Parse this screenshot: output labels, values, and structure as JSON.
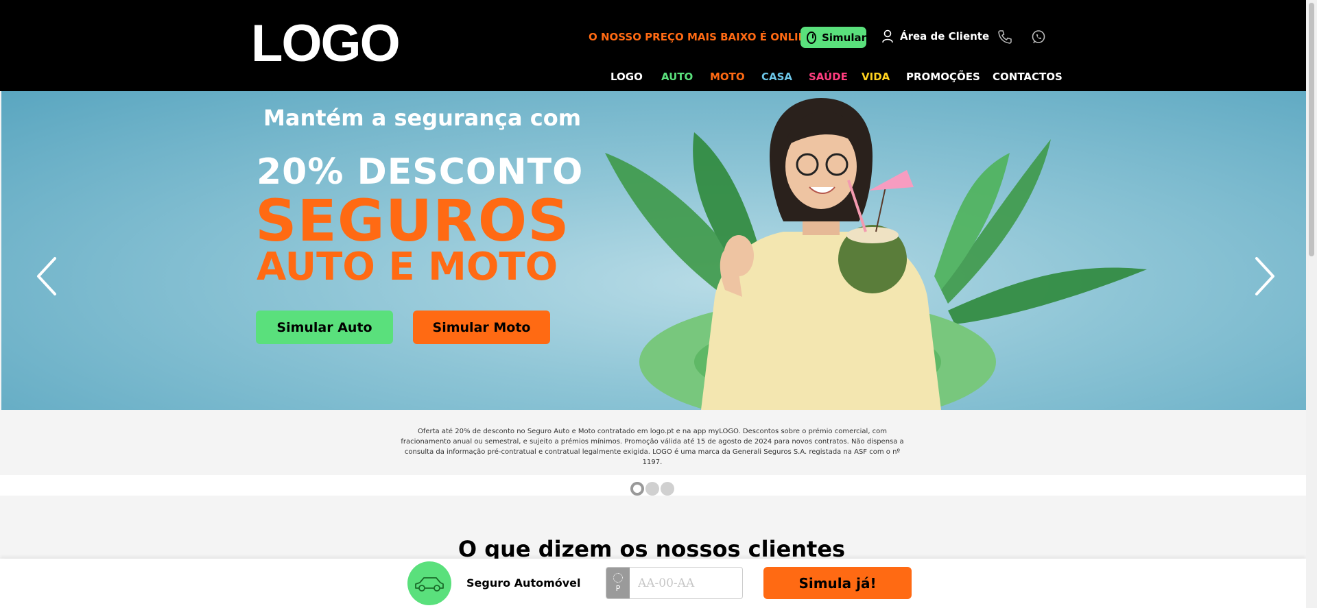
{
  "header": {
    "logo": "LOGO",
    "promo_text": "O NOSSO PREÇO MAIS BAIXO É ONLINE",
    "simular_label": "Simular",
    "area_cliente_label": "Área de Cliente"
  },
  "nav": {
    "items": [
      {
        "label": "LOGO",
        "color": "#ffffff"
      },
      {
        "label": "AUTO",
        "color": "#5ae07c"
      },
      {
        "label": "MOTO",
        "color": "#ff6a13"
      },
      {
        "label": "CASA",
        "color": "#6cc6e8"
      },
      {
        "label": "SAÚDE",
        "color": "#ff3d7f"
      },
      {
        "label": "VIDA",
        "color": "#ffd21f"
      },
      {
        "label": "PROMOÇÕES",
        "color": "#ffffff"
      },
      {
        "label": "CONTACTOS",
        "color": "#ffffff"
      }
    ]
  },
  "hero": {
    "subtitle": "Mantém a segurança com",
    "discount": "20% DESCONTO",
    "headline": "SEGUROS",
    "headline2": "AUTO E MOTO",
    "btn_auto": "Simular Auto",
    "btn_moto": "Simular Moto"
  },
  "disclaimer": "Oferta até 20% de desconto no Seguro Auto e Moto contratado em logo.pt e na app myLOGO. Descontos sobre o prémio comercial, com fracionamento anual ou semestral, e sujeito a prémios mínimos. Promoção válida até 15 de agosto de 2024 para novos contratos. Não dispensa a consulta da informação pré-contratual e contratual legalmente exigida. LOGO é uma marca da Generali Seguros S.A. registada na ASF com o nº 1197.",
  "carousel": {
    "slides": 3,
    "active": 1
  },
  "testimonials": {
    "title": "O que dizem os nossos clientes"
  },
  "bottom_bar": {
    "label": "Seguro Automóvel",
    "plate_flag": "P",
    "plate_placeholder": "AA-00-AA",
    "cta": "Simula já!"
  },
  "colors": {
    "brand_orange": "#ff6a13",
    "brand_green": "#5ae07c",
    "header_bg": "#000000"
  }
}
